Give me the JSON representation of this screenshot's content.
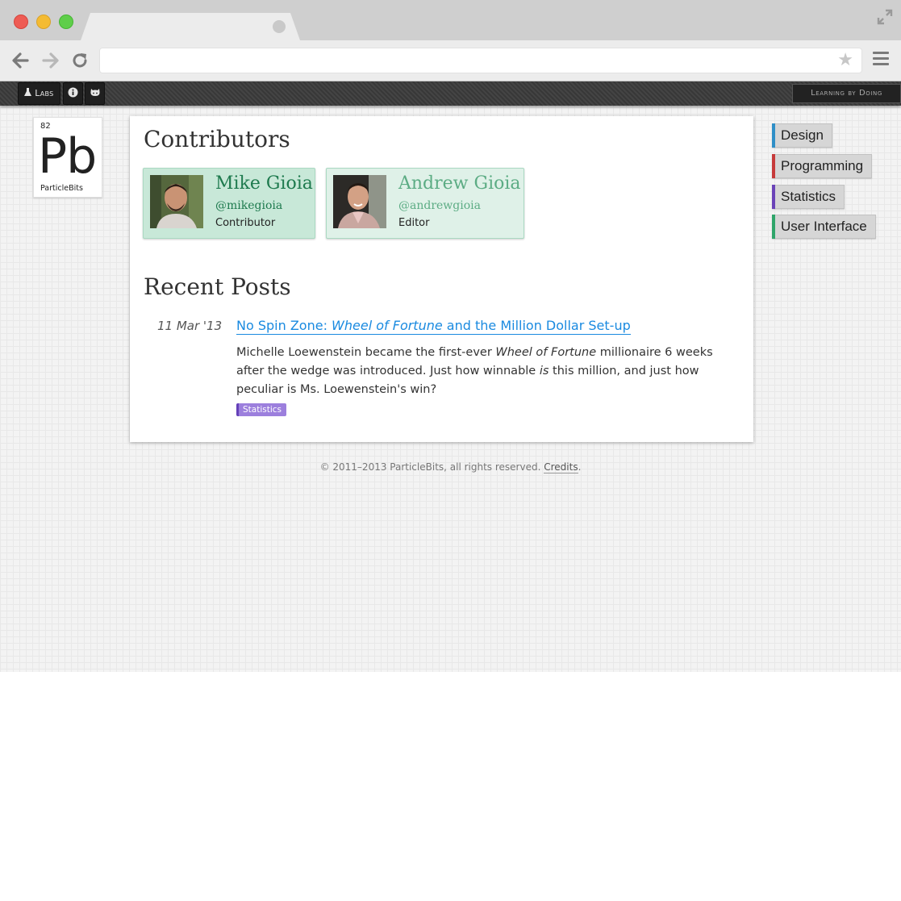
{
  "browser": {
    "url": "",
    "icons": {
      "back": "arrow-left-icon",
      "forward": "arrow-right-icon",
      "reload": "reload-icon",
      "bookmark": "star-icon",
      "menu": "hamburger-menu-icon",
      "fullscreen": "expand-icon"
    }
  },
  "sitebar": {
    "labs_label": "Labs",
    "tagline": "Learning by Doing"
  },
  "element_tile": {
    "number": "82",
    "symbol": "Pb",
    "name": "ParticleBits"
  },
  "contributors": {
    "title": "Contributors",
    "people": [
      {
        "name": "Mike Gioia",
        "handle": "@mikegioia",
        "role": "Contributor"
      },
      {
        "name": "Andrew Gioia",
        "handle": "@andrewgioia",
        "role": "Editor"
      }
    ]
  },
  "recent_posts": {
    "title": "Recent Posts",
    "posts": [
      {
        "date": "11 Mar '13",
        "title_prefix": "No Spin Zone: ",
        "title_em": "Wheel of Fortune",
        "title_suffix": " and the Million Dollar Set-up",
        "excerpt_1": "Michelle Loewenstein became the first-ever ",
        "excerpt_em1": "Wheel of Fortune",
        "excerpt_2": " millionaire 6 weeks after the wedge was introduced. Just how winnable ",
        "excerpt_em2": "is",
        "excerpt_3": " this million, and just how peculiar is Ms. Loewenstein's win?",
        "tag": "Statistics"
      }
    ]
  },
  "footer": {
    "copyright": "© 2011–2013 ParticleBits, all rights reserved. ",
    "credits_link": "Credits",
    "end": "."
  },
  "categories": [
    {
      "label": "Design",
      "accent": "#2f8fc7"
    },
    {
      "label": "Programming",
      "accent": "#c63a3a"
    },
    {
      "label": "Statistics",
      "accent": "#6a43b8"
    },
    {
      "label": "User Interface",
      "accent": "#2fa56a"
    }
  ],
  "colors": {
    "link": "#1a8ae0",
    "contributor_green": "#1e7a4e",
    "tag_purple": "#9c7fdd"
  }
}
